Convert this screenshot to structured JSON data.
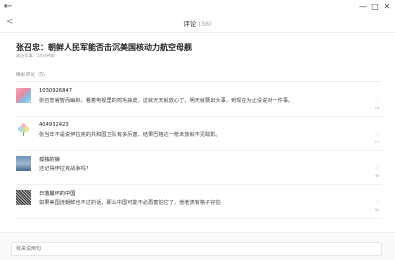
{
  "window": {
    "back_icon": "←",
    "minimize_icon": "—",
    "maximize_icon": "□",
    "close_icon": "✕"
  },
  "header": {
    "back_icon": "<",
    "title": "评论",
    "count": "(38)"
  },
  "article": {
    "title": "张召忠：朝鲜人民军能否击沉美国核动力航空母舰",
    "source": "政治军事",
    "time": "14分钟前"
  },
  "comments_section": {
    "label": "精彩评论（5）"
  },
  "comments": [
    {
      "user": "1030926847",
      "text": "张召忠睿智而幽默，看着电视里的鸡毛蒜皮，这就天天就放心了，明天就要出大事，到现在为止没说对一件事。",
      "likes": "10"
    },
    {
      "user": "404932423",
      "text": "张当年不是说伊拉克的共和国卫队有多厉害，结果巴格达一枪未放就不见踪影。",
      "likes": "11"
    },
    {
      "user": "孤独的狼",
      "text": "还记得伊拉克战争吗？",
      "likes": "46"
    },
    {
      "user": "日落崩坏的中国",
      "text": "如果美国连朝鲜也不过的话，那么中国可能不必再害怕它了，他老虎有格子好怕",
      "likes": "34"
    }
  ],
  "input": {
    "placeholder": "我来说两句"
  },
  "colors": {
    "background": "#ffffff",
    "divider": "#eeeeee",
    "muted_text": "#999999"
  }
}
